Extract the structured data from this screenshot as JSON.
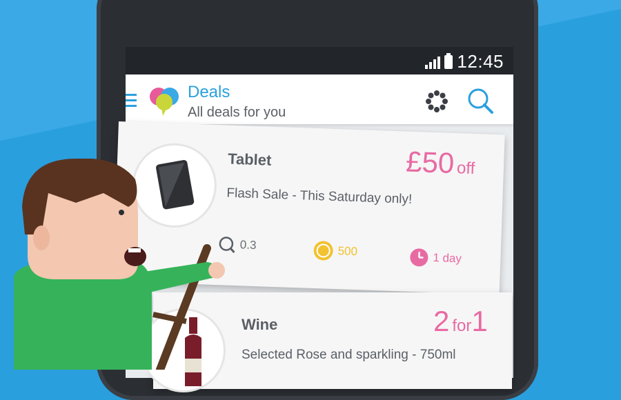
{
  "status_bar": {
    "time": "12:45"
  },
  "app_bar": {
    "menu_icon": "menu-icon",
    "logo": "speech-bubbles-logo",
    "title": "Deals",
    "subtitle": "All deals for you",
    "actions": [
      "settings-icon",
      "search-icon"
    ]
  },
  "deals": [
    {
      "title": "Tablet",
      "description": "Flash Sale - This Saturday only!",
      "price_main": "£50",
      "price_unit": "off",
      "distance": "0.3",
      "points": "500",
      "expires": "1 day",
      "icon": "tablet-icon"
    },
    {
      "title": "Wine",
      "description": "Selected Rose and sparkling - 750ml",
      "price_main": "2",
      "price_unit": "for",
      "price_extra": "1",
      "icon": "wine-bottle-icon"
    }
  ],
  "colors": {
    "background": "#2a9fde",
    "accent_blue": "#2aa0dd",
    "accent_pink": "#e86aa3",
    "coin_yellow": "#f2c230",
    "character_shirt": "#36b35a"
  }
}
